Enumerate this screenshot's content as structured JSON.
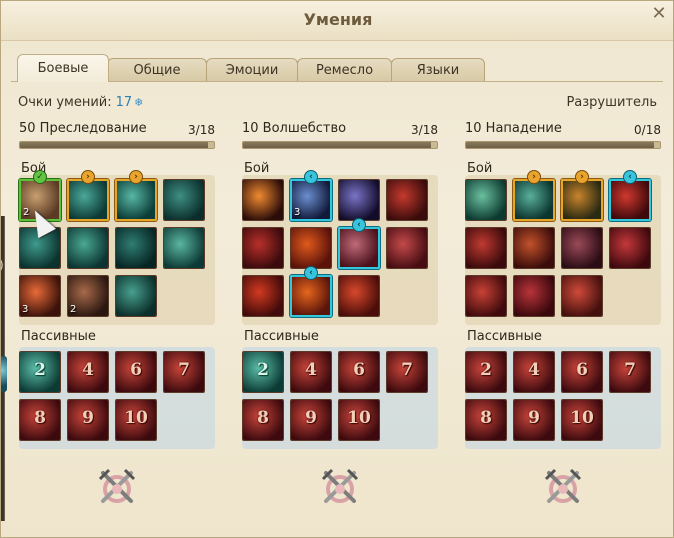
{
  "window": {
    "title": "Умения",
    "close_icon": "close-icon"
  },
  "tabs": [
    {
      "label": "Боевые",
      "active": true
    },
    {
      "label": "Общие",
      "active": false
    },
    {
      "label": "Эмоции",
      "active": false
    },
    {
      "label": "Ремесло",
      "active": false
    },
    {
      "label": "Языки",
      "active": false
    }
  ],
  "skill_points": {
    "label": "Очки умений:",
    "value": "17",
    "icon": "snowflake-icon"
  },
  "class_name": "Разрушитель",
  "trees": [
    {
      "name": "50 Преследование",
      "count": "3/18",
      "progress": 0.97,
      "combat_label": "Бой",
      "passive_label": "Пассивные",
      "combat": [
        {
          "icon": "dagger-slash-icon",
          "rank": "2",
          "highlight": "green",
          "badge": "check",
          "c1": "#c8a070",
          "c2": "#5a3a24"
        },
        {
          "icon": "poison-drop-icon",
          "rank": "",
          "highlight": "orange",
          "badge": "arrow-right",
          "c1": "#4aa89a",
          "c2": "#0e3a35"
        },
        {
          "icon": "arrow-throw-icon",
          "rank": "",
          "highlight": "orange",
          "badge": "arrow-right",
          "c1": "#58b8a6",
          "c2": "#0c3d38"
        },
        {
          "icon": "serpent-icon",
          "rank": "",
          "highlight": "",
          "badge": "",
          "c1": "#3e8f84",
          "c2": "#0b2e2b"
        },
        {
          "icon": "target-circle-icon",
          "rank": "",
          "highlight": "",
          "badge": "",
          "c1": "#3f9a8e",
          "c2": "#0b322d"
        },
        {
          "icon": "charge-icon",
          "rank": "",
          "highlight": "",
          "badge": "",
          "c1": "#4aa893",
          "c2": "#0c3531"
        },
        {
          "icon": "shadow-strike-icon",
          "rank": "",
          "highlight": "",
          "badge": "",
          "c1": "#2f7e74",
          "c2": "#072523"
        },
        {
          "icon": "net-trap-icon",
          "rank": "",
          "highlight": "",
          "badge": "",
          "c1": "#5ab6a2",
          "c2": "#0d3a34"
        },
        {
          "icon": "missile-icon",
          "rank": "3",
          "highlight": "",
          "badge": "",
          "c1": "#e86a38",
          "c2": "#3a120a"
        },
        {
          "icon": "triple-arrow-icon",
          "rank": "2",
          "highlight": "",
          "badge": "",
          "c1": "#a86a4a",
          "c2": "#2a1710"
        },
        {
          "icon": "hooded-rogue-icon",
          "rank": "",
          "highlight": "",
          "badge": "",
          "c1": "#48a08f",
          "c2": "#0b2e2a"
        }
      ],
      "passive": [
        {
          "icon": "passive-2-icon",
          "num": "2",
          "teal": true
        },
        {
          "icon": "passive-4-icon",
          "num": "4",
          "teal": false
        },
        {
          "icon": "passive-6-icon",
          "num": "6",
          "teal": false
        },
        {
          "icon": "passive-7-icon",
          "num": "7",
          "teal": false
        },
        {
          "icon": "passive-8-icon",
          "num": "8",
          "teal": false
        },
        {
          "icon": "passive-9-icon",
          "num": "9",
          "teal": false
        },
        {
          "icon": "passive-10-icon",
          "num": "10",
          "teal": false
        }
      ],
      "reset_icon": "crossed-swords-reset-icon"
    },
    {
      "name": "10 Волшебство",
      "count": "3/18",
      "progress": 0.97,
      "combat_label": "Бой",
      "passive_label": "Пассивные",
      "combat": [
        {
          "icon": "fireball-icon",
          "rank": "",
          "highlight": "",
          "badge": "",
          "c1": "#f08a30",
          "c2": "#2a0c08"
        },
        {
          "icon": "ice-lance-icon",
          "rank": "3",
          "highlight": "cyan",
          "badge": "arrow-left",
          "c1": "#6a8fd0",
          "c2": "#121a3a"
        },
        {
          "icon": "lightning-bolt-icon",
          "rank": "",
          "highlight": "",
          "badge": "",
          "c1": "#7a74c8",
          "c2": "#120c2a"
        },
        {
          "icon": "chain-lightning-icon",
          "rank": "",
          "highlight": "",
          "badge": "",
          "c1": "#c43a2e",
          "c2": "#3a0b0b"
        },
        {
          "icon": "fire-wave-icon",
          "rank": "",
          "highlight": "",
          "badge": "",
          "c1": "#b8302a",
          "c2": "#3a0a0c"
        },
        {
          "icon": "flame-storm-icon",
          "rank": "",
          "highlight": "",
          "badge": "",
          "c1": "#e05a1c",
          "c2": "#5a120a"
        },
        {
          "icon": "magic-boot-icon",
          "rank": "",
          "highlight": "cyan",
          "badge": "arrow-left",
          "c1": "#c06a78",
          "c2": "#4a121c"
        },
        {
          "icon": "arcane-shield-icon",
          "rank": "",
          "highlight": "",
          "badge": "",
          "c1": "#c44a4a",
          "c2": "#460d12"
        },
        {
          "icon": "inferno-burst-icon",
          "rank": "",
          "highlight": "",
          "badge": "",
          "c1": "#d23a20",
          "c2": "#420a0a"
        },
        {
          "icon": "meteor-icon",
          "rank": "",
          "highlight": "cyan",
          "badge": "arrow-left",
          "c1": "#e6661e",
          "c2": "#5a140a"
        },
        {
          "icon": "flame-column-icon",
          "rank": "",
          "highlight": "",
          "badge": "",
          "c1": "#d8482a",
          "c2": "#4a0d0a"
        }
      ],
      "passive": [
        {
          "icon": "passive-2-icon",
          "num": "2",
          "teal": true
        },
        {
          "icon": "passive-4-icon",
          "num": "4",
          "teal": false
        },
        {
          "icon": "passive-6-icon",
          "num": "6",
          "teal": false
        },
        {
          "icon": "passive-7-icon",
          "num": "7",
          "teal": false
        },
        {
          "icon": "passive-8-icon",
          "num": "8",
          "teal": false
        },
        {
          "icon": "passive-9-icon",
          "num": "9",
          "teal": false
        },
        {
          "icon": "passive-10-icon",
          "num": "10",
          "teal": false
        }
      ],
      "reset_icon": "crossed-swords-reset-icon"
    },
    {
      "name": "10 Нападение",
      "count": "0/18",
      "progress": 0.97,
      "combat_label": "Бой",
      "passive_label": "Пассивные",
      "combat": [
        {
          "icon": "whirlwind-slash-icon",
          "rank": "",
          "highlight": "",
          "badge": "",
          "c1": "#6ac0a0",
          "c2": "#0d3a30"
        },
        {
          "icon": "sword-thrust-icon",
          "rank": "",
          "highlight": "orange",
          "badge": "arrow-right",
          "c1": "#58b09a",
          "c2": "#0c3530"
        },
        {
          "icon": "tornado-icon",
          "rank": "",
          "highlight": "orange",
          "badge": "arrow-right",
          "c1": "#c8842c",
          "c2": "#2a2a12"
        },
        {
          "icon": "blood-rune-icon",
          "rank": "",
          "highlight": "cyan",
          "badge": "arrow-left",
          "c1": "#d0382e",
          "c2": "#3e090c"
        },
        {
          "icon": "lasso-icon",
          "rank": "",
          "highlight": "",
          "badge": "",
          "c1": "#c03a30",
          "c2": "#3a0a0c"
        },
        {
          "icon": "demon-rage-icon",
          "rank": "",
          "highlight": "",
          "badge": "",
          "c1": "#c2522c",
          "c2": "#3a0c0a"
        },
        {
          "icon": "shield-bash-icon",
          "rank": "",
          "highlight": "",
          "badge": "",
          "c1": "#9a4a58",
          "c2": "#2a0c14"
        },
        {
          "icon": "spear-throw-icon",
          "rank": "",
          "highlight": "",
          "badge": "",
          "c1": "#c4383a",
          "c2": "#3e090e"
        },
        {
          "icon": "slash-wave-icon",
          "rank": "",
          "highlight": "",
          "badge": "",
          "c1": "#c84236",
          "c2": "#400a0c"
        },
        {
          "icon": "sword-rain-icon",
          "rank": "",
          "highlight": "",
          "badge": "",
          "c1": "#b8343a",
          "c2": "#3a080c"
        },
        {
          "icon": "vortex-icon",
          "rank": "",
          "highlight": "",
          "badge": "",
          "c1": "#d04a3a",
          "c2": "#44100e"
        }
      ],
      "passive": [
        {
          "icon": "passive-2-icon",
          "num": "2",
          "teal": false
        },
        {
          "icon": "passive-4-icon",
          "num": "4",
          "teal": false
        },
        {
          "icon": "passive-6-icon",
          "num": "6",
          "teal": false
        },
        {
          "icon": "passive-7-icon",
          "num": "7",
          "teal": false
        },
        {
          "icon": "passive-8-icon",
          "num": "8",
          "teal": false
        },
        {
          "icon": "passive-9-icon",
          "num": "9",
          "teal": false
        },
        {
          "icon": "passive-10-icon",
          "num": "10",
          "teal": false
        }
      ],
      "reset_icon": "crossed-swords-reset-icon"
    }
  ],
  "side_panel": {
    "text": ")"
  }
}
